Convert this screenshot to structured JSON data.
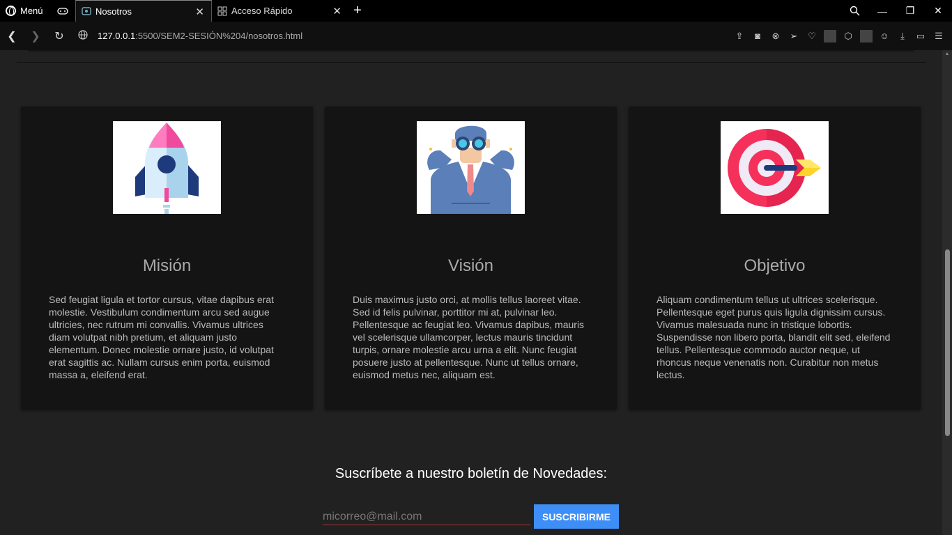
{
  "browser": {
    "menu_label": "Menú",
    "tabs": [
      {
        "title": "Nosotros",
        "active": true
      },
      {
        "title": "Acceso Rápido",
        "active": false
      }
    ],
    "url_host": "127.0.0.1",
    "url_path": ":5500/SEM2-SESIÓN%204/nosotros.html"
  },
  "cards": [
    {
      "title": "Misión",
      "icon": "rocket-icon",
      "text": "Sed feugiat ligula et tortor cursus, vitae dapibus erat molestie. Vestibulum condimentum arcu sed augue ultricies, nec rutrum mi convallis. Vivamus ultrices diam volutpat nibh pretium, et aliquam justo elementum. Donec molestie ornare justo, id volutpat erat sagittis ac. Nullam cursus enim porta, euismod massa a, eleifend erat."
    },
    {
      "title": "Visión",
      "icon": "binoculars-man-icon",
      "text": "Duis maximus justo orci, at mollis tellus laoreet vitae. Sed id felis pulvinar, porttitor mi at, pulvinar leo. Pellentesque ac feugiat leo. Vivamus dapibus, mauris vel scelerisque ullamcorper, lectus mauris tincidunt turpis, ornare molestie arcu urna a elit. Nunc feugiat posuere justo at pellentesque. Nunc ut tellus ornare, euismod metus nec, aliquam est."
    },
    {
      "title": "Objetivo",
      "icon": "target-icon",
      "text": "Aliquam condimentum tellus ut ultrices scelerisque. Pellentesque eget purus quis ligula dignissim cursus. Vivamus malesuada nunc in tristique lobortis. Suspendisse non libero porta, blandit elit sed, eleifend tellus. Pellentesque commodo auctor neque, ut rhoncus neque venenatis non. Curabitur non metus lectus."
    }
  ],
  "newsletter": {
    "title": "Suscríbete a nuestro boletín de Novedades:",
    "placeholder": "micorreo@mail.com",
    "button_label": "SUSCRIBIRME"
  },
  "colors": {
    "accent": "#3e8ef7",
    "background": "#212121",
    "card": "#141414"
  }
}
